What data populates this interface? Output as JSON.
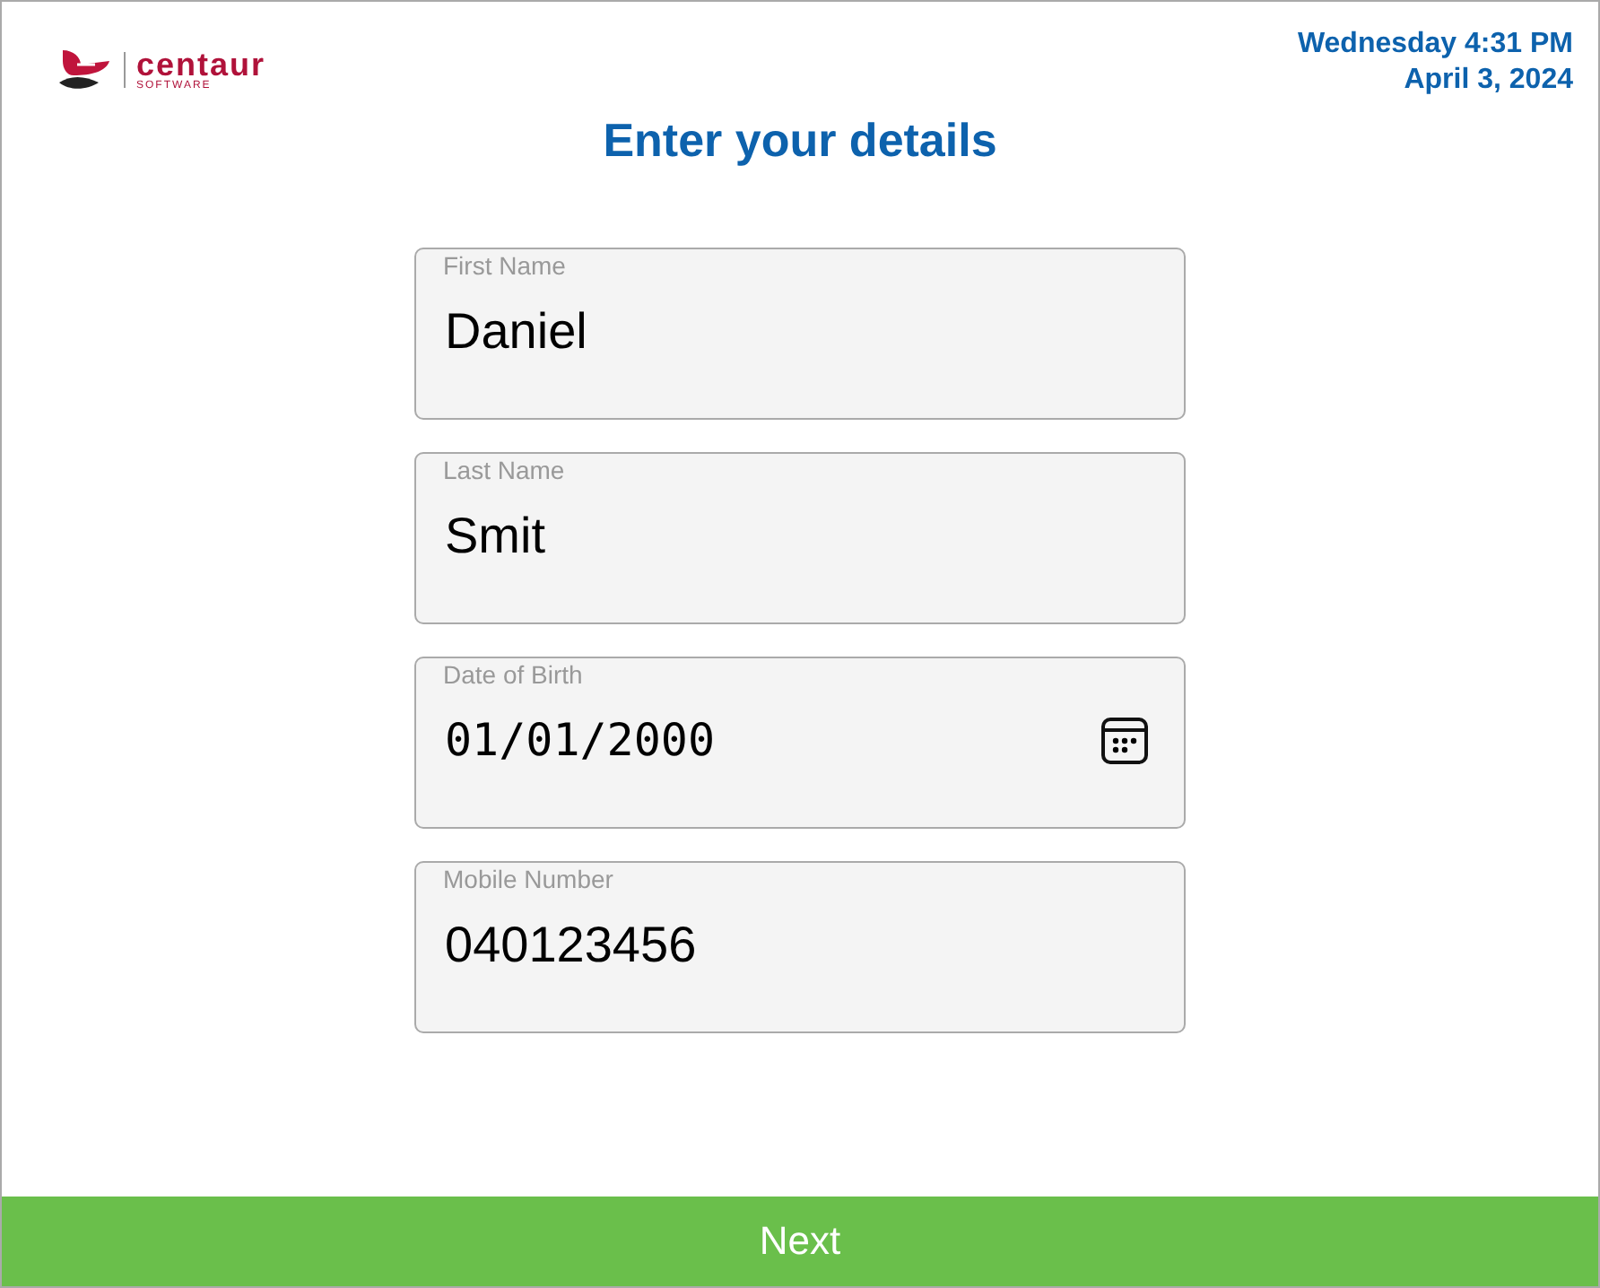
{
  "logo": {
    "name": "centaur",
    "tagline": "SOFTWARE"
  },
  "datetime": {
    "day_time": "Wednesday 4:31 PM",
    "date": "April 3, 2024"
  },
  "title": "Enter your details",
  "fields": [
    {
      "kind": "text",
      "label": "First Name",
      "value": "Daniel"
    },
    {
      "kind": "text",
      "label": "Last Name",
      "value": "Smit"
    },
    {
      "kind": "date",
      "label": "Date of Birth",
      "value": "01/01/2000"
    },
    {
      "kind": "text",
      "label": "Mobile Number",
      "value": "040123456"
    }
  ],
  "button": "Next"
}
